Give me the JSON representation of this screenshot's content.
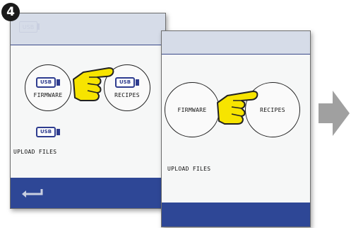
{
  "step_number": "4",
  "back_screen": {
    "status_usb_label": "USB",
    "buttons": [
      {
        "label": "FIRMWARE",
        "usb_label": "USB"
      },
      {
        "label": "RECIPES",
        "usb_label": "USB"
      }
    ],
    "upload": {
      "label": "UPLOAD FILES",
      "usb_label": "USB"
    }
  },
  "front_screen": {
    "buttons": [
      {
        "label": "FIRMWARE"
      },
      {
        "label": "RECIPES"
      }
    ],
    "upload": {
      "label": "UPLOAD FILES"
    }
  },
  "icons": {
    "hand": "pointing-hand-icon",
    "back": "return-arrow-icon",
    "next": "right-arrow-icon"
  },
  "colors": {
    "header": "#d6dce8",
    "footer": "#2e4796",
    "usb_blue": "#2e3c8f",
    "hand_yellow": "#f7e400",
    "arrow_gray": "#a0a0a0"
  }
}
